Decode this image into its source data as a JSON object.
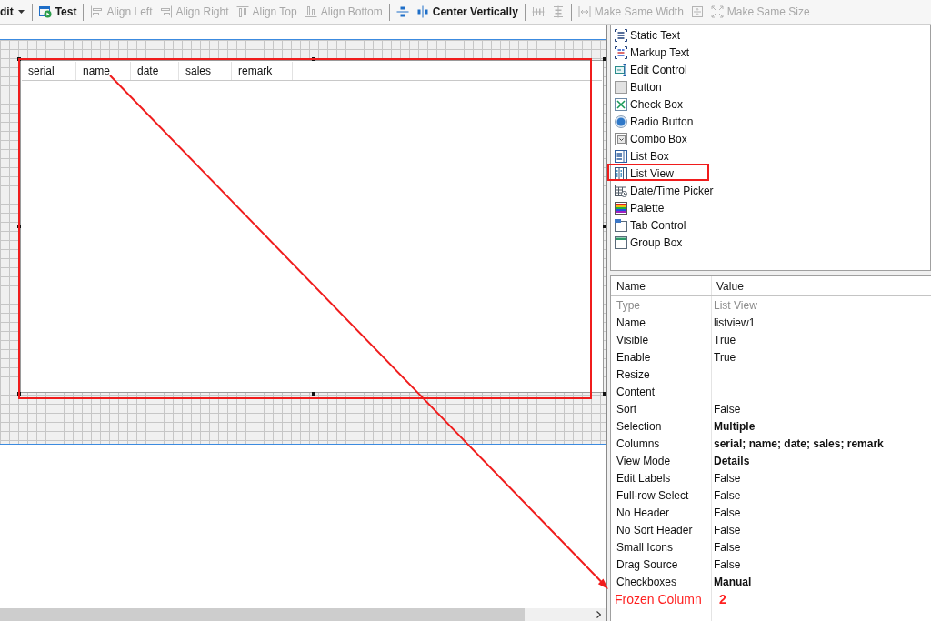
{
  "toolbar": {
    "groups": [
      {
        "items": [
          {
            "kind": "dropdown",
            "label": "dit",
            "disabled": false
          }
        ]
      },
      {
        "items": [
          {
            "kind": "button",
            "label": "Test",
            "disabled": false
          }
        ]
      },
      {
        "items": [
          {
            "kind": "button",
            "label": "Align Left",
            "disabled": true
          },
          {
            "kind": "button",
            "label": "Align Right",
            "disabled": true
          },
          {
            "kind": "button",
            "label": "Align Top",
            "disabled": true
          },
          {
            "kind": "button",
            "label": "Align Bottom",
            "disabled": true
          }
        ]
      },
      {
        "items": [
          {
            "kind": "icon",
            "disabled": false
          },
          {
            "kind": "button",
            "label": "Center Vertically",
            "disabled": false
          }
        ]
      },
      {
        "items": [
          {
            "kind": "icon",
            "disabled": true
          },
          {
            "kind": "icon",
            "disabled": true
          }
        ]
      },
      {
        "items": [
          {
            "kind": "button",
            "label": "Make Same Width",
            "disabled": true
          },
          {
            "kind": "icon",
            "disabled": true
          },
          {
            "kind": "button",
            "label": "Make Same Size",
            "disabled": true
          }
        ]
      }
    ]
  },
  "canvas": {
    "list_view": {
      "columns": [
        "serial",
        "name",
        "date",
        "sales",
        "remark"
      ]
    }
  },
  "toolbox": {
    "items": [
      {
        "label": "Static Text",
        "highlighted": false
      },
      {
        "label": "Markup Text",
        "highlighted": false
      },
      {
        "label": "Edit Control",
        "highlighted": false
      },
      {
        "label": "Button",
        "highlighted": false
      },
      {
        "label": "Check Box",
        "highlighted": false
      },
      {
        "label": "Radio Button",
        "highlighted": false
      },
      {
        "label": "Combo Box",
        "highlighted": false
      },
      {
        "label": "List Box",
        "highlighted": false
      },
      {
        "label": "List View",
        "highlighted": true
      },
      {
        "label": "Date/Time Picker",
        "highlighted": false
      },
      {
        "label": "Palette",
        "highlighted": false
      },
      {
        "label": "Tab Control",
        "highlighted": false
      },
      {
        "label": "Group Box",
        "highlighted": false
      }
    ]
  },
  "properties": {
    "columns": [
      "Name",
      "Value"
    ],
    "rows": [
      {
        "name": "Type",
        "value": "List View",
        "readonly": true,
        "modified": false,
        "highlighted": false
      },
      {
        "name": "Name",
        "value": "listview1",
        "readonly": false,
        "modified": false,
        "highlighted": false
      },
      {
        "name": "Visible",
        "value": "True",
        "readonly": false,
        "modified": false,
        "highlighted": false
      },
      {
        "name": "Enable",
        "value": "True",
        "readonly": false,
        "modified": false,
        "highlighted": false
      },
      {
        "name": "Resize",
        "readonly": false,
        "highlighted": false
      },
      {
        "name": "Content",
        "readonly": false,
        "highlighted": false
      },
      {
        "name": "Sort",
        "value": "False",
        "readonly": false,
        "modified": false,
        "highlighted": false
      },
      {
        "name": "Selection",
        "value": "Multiple",
        "readonly": false,
        "modified": true,
        "highlighted": false
      },
      {
        "name": "Columns",
        "value": "serial; name; date; sales; remark",
        "readonly": false,
        "modified": true,
        "highlighted": false
      },
      {
        "name": "View Mode",
        "value": "Details",
        "readonly": false,
        "modified": true,
        "highlighted": false
      },
      {
        "name": "Edit Labels",
        "value": "False",
        "readonly": false,
        "modified": false,
        "highlighted": false
      },
      {
        "name": "Full-row Select",
        "value": "False",
        "readonly": false,
        "modified": false,
        "highlighted": false
      },
      {
        "name": "No Header",
        "value": "False",
        "readonly": false,
        "modified": false,
        "highlighted": false
      },
      {
        "name": "No Sort Header",
        "value": "False",
        "readonly": false,
        "modified": false,
        "highlighted": false
      },
      {
        "name": "Small Icons",
        "value": "False",
        "readonly": false,
        "modified": false,
        "highlighted": false
      },
      {
        "name": "Drag Source",
        "value": "False",
        "readonly": false,
        "modified": false,
        "highlighted": false
      },
      {
        "name": "Checkboxes",
        "value": "Manual",
        "readonly": false,
        "modified": true,
        "highlighted": false
      },
      {
        "name": "Frozen Column",
        "value": "2",
        "readonly": false,
        "modified": true,
        "highlighted": true
      }
    ]
  }
}
